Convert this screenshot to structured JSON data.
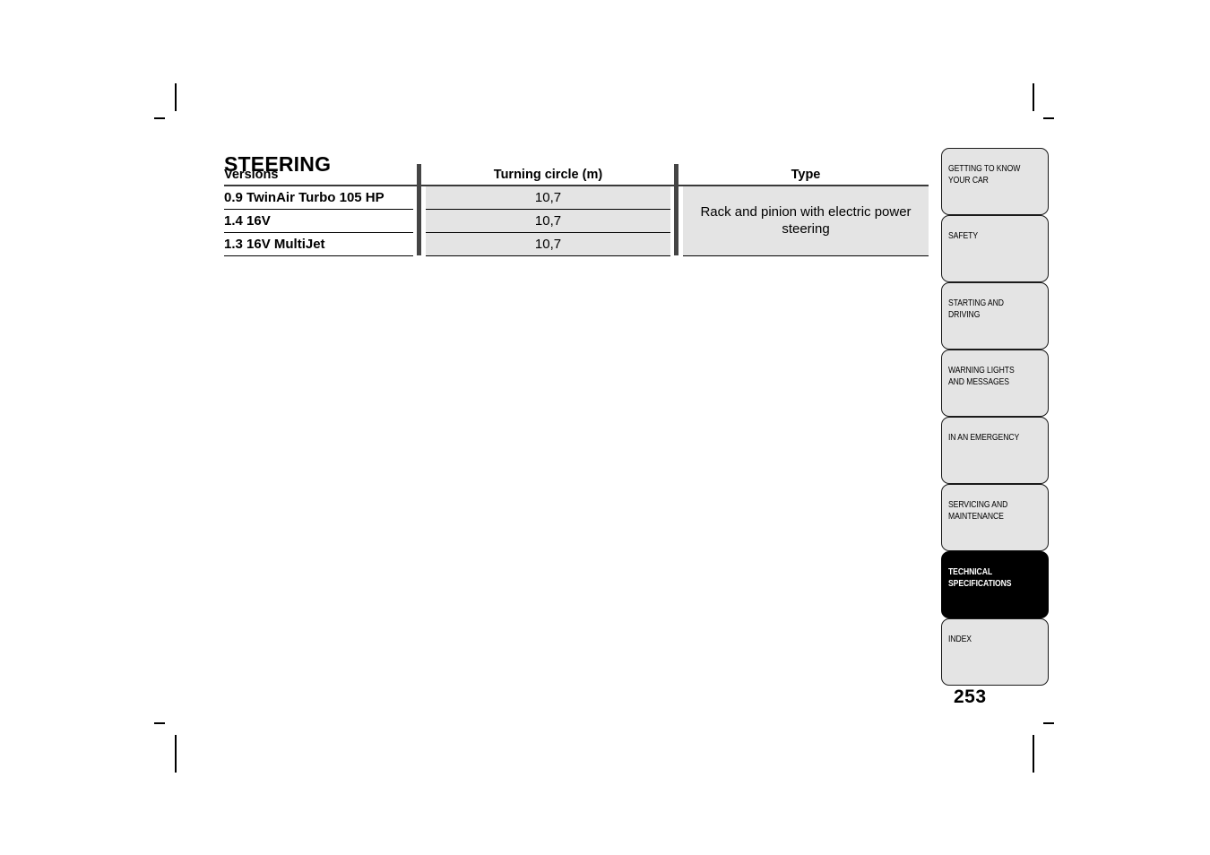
{
  "page": {
    "title": "STEERING",
    "number": "253"
  },
  "table": {
    "headers": {
      "versions": "Versions",
      "turning_circle": "Turning circle (m)",
      "type": "Type"
    },
    "rows": [
      {
        "version": "0.9 TwinAir Turbo 105 HP",
        "turning_circle": "10,7"
      },
      {
        "version": "1.4 16V",
        "turning_circle": "10,7"
      },
      {
        "version": "1.3 16V MultiJet",
        "turning_circle": "10,7"
      }
    ],
    "type_value": "Rack and pinion with electric power steering"
  },
  "sidebar": {
    "tabs": [
      {
        "label": "GETTING TO KNOW\nYOUR CAR",
        "active": false
      },
      {
        "label": "SAFETY",
        "active": false
      },
      {
        "label": "STARTING AND\nDRIVING",
        "active": false
      },
      {
        "label": "WARNING LIGHTS\nAND MESSAGES",
        "active": false
      },
      {
        "label": "IN AN EMERGENCY",
        "active": false
      },
      {
        "label": "SERVICING AND\nMAINTENANCE",
        "active": false
      },
      {
        "label": "TECHNICAL\nSPECIFICATIONS",
        "active": true
      },
      {
        "label": "INDEX",
        "active": false
      }
    ]
  },
  "colors": {
    "cell_fill": "#e4e4e4",
    "separator": "#454545",
    "active_tab_bg": "#000000",
    "tab_fill": "#e4e4e4"
  }
}
